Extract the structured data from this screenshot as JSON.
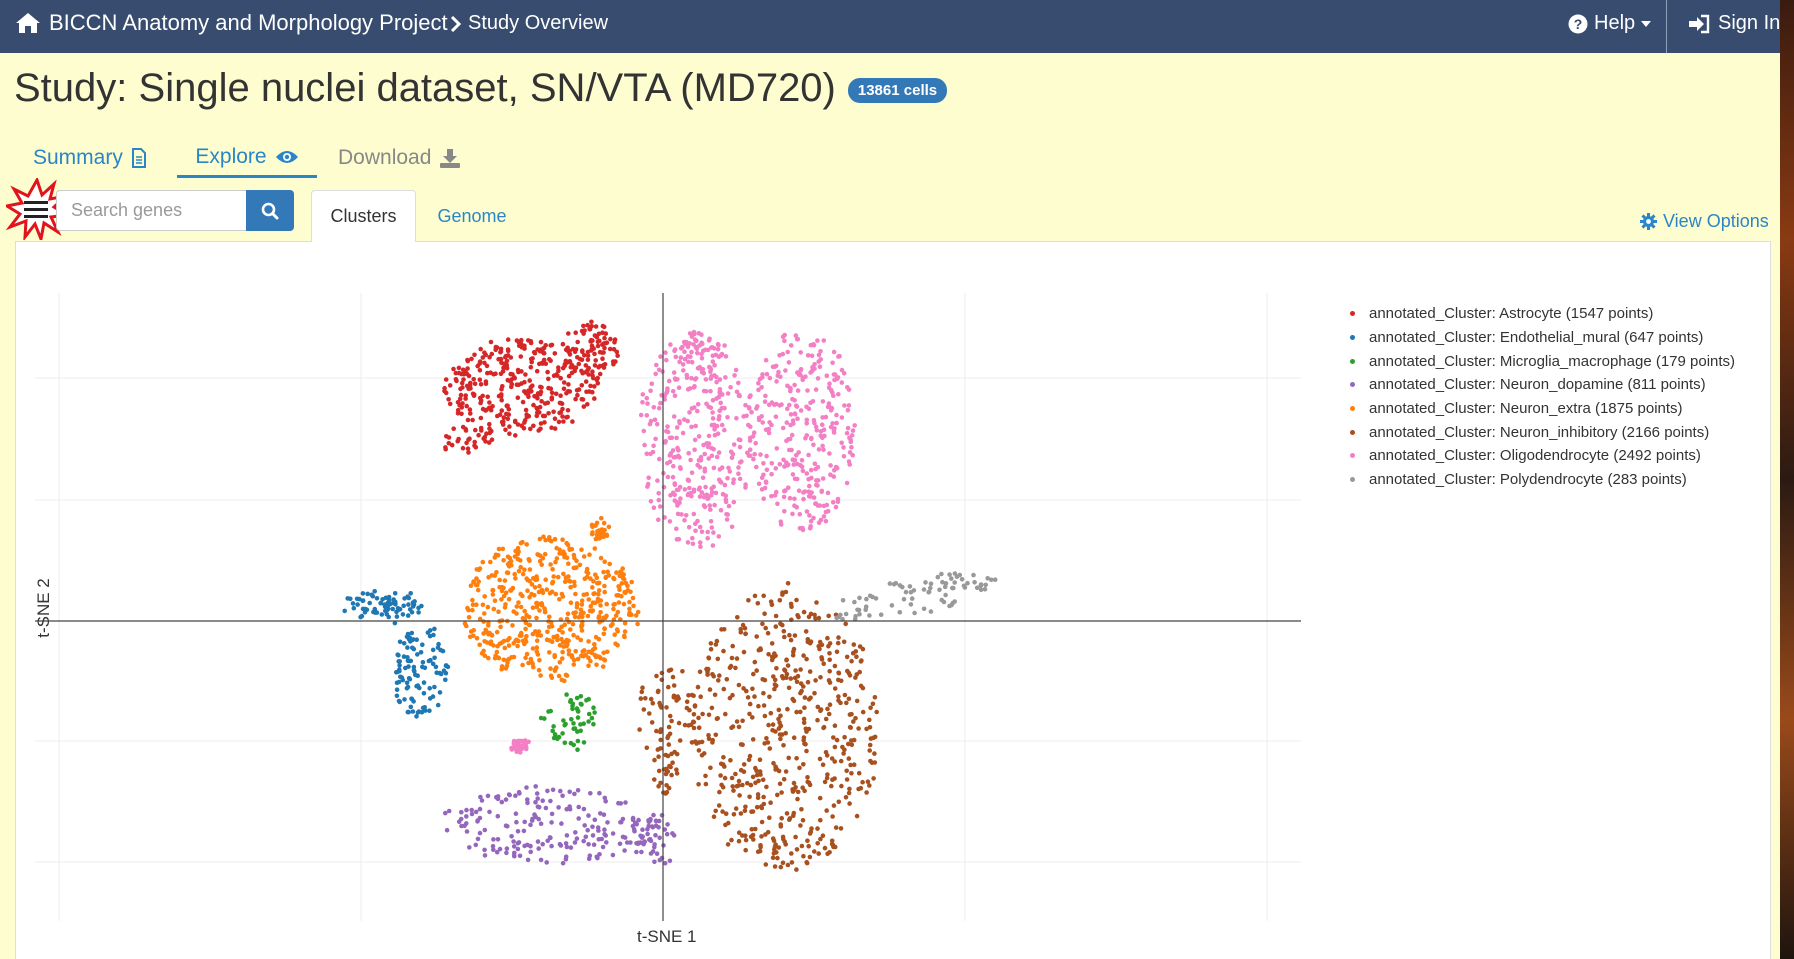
{
  "topnav": {
    "brand": "BICCN Anatomy and Morphology Project",
    "breadcrumb": "Study Overview",
    "help": "Help",
    "signin": "Sign In"
  },
  "study": {
    "title": "Study: Single nuclei dataset, SN/VTA (MD720)",
    "cells_badge": "13861 cells"
  },
  "tabs": [
    {
      "label": "Summary",
      "icon": "file-icon",
      "state": "link"
    },
    {
      "label": "Explore",
      "icon": "eye-icon",
      "state": "active"
    },
    {
      "label": "Download",
      "icon": "download-icon",
      "state": "disabled"
    }
  ],
  "search": {
    "placeholder": "Search genes"
  },
  "subtabs": {
    "clusters": "Clusters",
    "genome": "Genome"
  },
  "view_options": "View Options",
  "chart_data": {
    "type": "scatter",
    "xlabel": "t-SNE 1",
    "ylabel": "t-SNE 2",
    "grid": true,
    "legend_position": "top-right",
    "series": [
      {
        "name": "annotated_Cluster: Astrocyte (1547 points)",
        "color": "#d62728",
        "count": 1547
      },
      {
        "name": "annotated_Cluster: Endothelial_mural (647 points)",
        "color": "#1f77b4",
        "count": 647
      },
      {
        "name": "annotated_Cluster: Microglia_macrophage (179 points)",
        "color": "#2ca02c",
        "count": 179
      },
      {
        "name": "annotated_Cluster: Neuron_dopamine (811 points)",
        "color": "#9467bd",
        "count": 811
      },
      {
        "name": "annotated_Cluster: Neuron_extra (1875 points)",
        "color": "#ff7f0e",
        "count": 1875
      },
      {
        "name": "annotated_Cluster: Neuron_inhibitory (2166 points)",
        "color": "#a9501f",
        "count": 2166
      },
      {
        "name": "annotated_Cluster: Oligodendrocyte (2492 points)",
        "color": "#f37fc4",
        "count": 2492
      },
      {
        "name": "annotated_Cluster: Polydendrocyte (283 points)",
        "color": "#999999",
        "count": 283
      }
    ]
  }
}
